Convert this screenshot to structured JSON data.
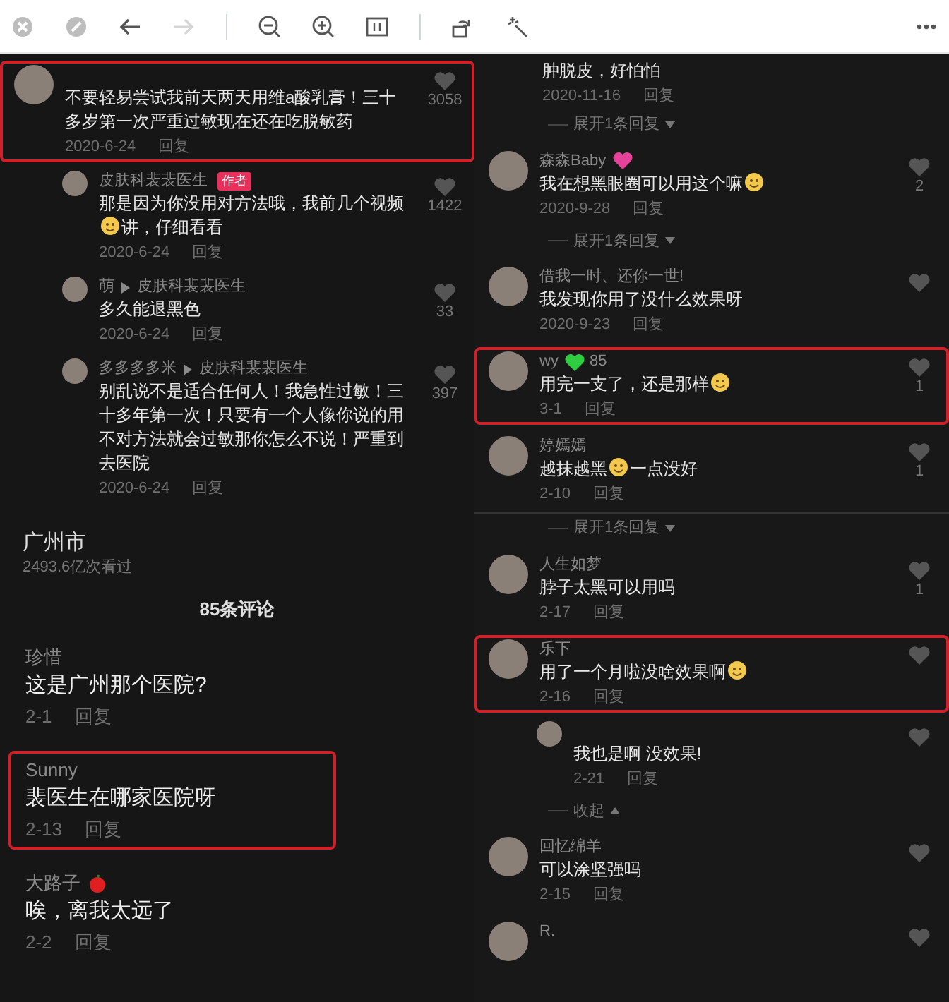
{
  "toolbar": [
    {
      "kind": "close"
    },
    {
      "kind": "minimize"
    },
    {
      "kind": "back",
      "disabled": false
    },
    {
      "kind": "forward",
      "disabled": true
    },
    {
      "kind": "separator"
    },
    {
      "kind": "zoom_out"
    },
    {
      "kind": "zoom_in"
    },
    {
      "kind": "fit"
    },
    {
      "kind": "separator"
    },
    {
      "kind": "rotate"
    },
    {
      "kind": "enhance"
    },
    {
      "kind": "spacer"
    },
    {
      "kind": "more"
    }
  ],
  "left_panel": [
    {
      "kind": "comment",
      "highlighted": true,
      "text": [
        "不要轻易尝试我前天两天用维a酸乳膏！三十多岁第一次严重过敏现在还在吃脱敏药"
      ],
      "date": "2020-6-24",
      "reply": "回复",
      "likes": "3058"
    },
    {
      "kind": "reply",
      "name": "皮肤科裴裴医生",
      "tag": "作者",
      "highlighted": false,
      "text": [
        "那是因为你没用对方法哦，我前几个视频",
        "讲，仔细看看"
      ],
      "date": "2020-6-24",
      "reply": "回复",
      "likes": "1422"
    },
    {
      "kind": "reply",
      "name": "萌",
      "reply_to": "皮肤科裴裴医生",
      "highlighted": false,
      "text": [
        "多久能退黑色"
      ],
      "date": "2020-6-24",
      "reply": "回复",
      "likes": "33"
    },
    {
      "kind": "reply",
      "name": "多多多多米",
      "reply_to": "皮肤科裴裴医生",
      "highlighted": false,
      "text": [
        "别乱说不是适合任何人！我急性过敏！三十多年第一次！只要有一个人像你说的用不对方法就会过敏那你怎么不说！严重到去医院"
      ],
      "date": "2020-6-24",
      "reply": "回复",
      "likes": "397"
    },
    {
      "kind": "location",
      "text": "广州市",
      "views": "2493.6亿次看过"
    },
    {
      "kind": "count",
      "text": "85条评论"
    },
    {
      "kind": "plain",
      "name": "珍惜",
      "highlighted": false,
      "text": [
        "这是广州那个医院?"
      ],
      "date": "2-1",
      "reply": "回复"
    },
    {
      "kind": "plain",
      "name": "Sunny",
      "highlighted": true,
      "text": [
        "裴医生在哪家医院呀"
      ],
      "date": "2-13",
      "reply": "回复"
    },
    {
      "kind": "plain",
      "name": "大路子",
      "badge": {
        "kind": "apple"
      },
      "highlighted": false,
      "text": [
        "唉，离我太远了"
      ],
      "date": "2-2",
      "reply": "回复"
    }
  ],
  "right_panel": [
    {
      "kind": "continuation",
      "text": [
        "肿脱皮，好怕怕"
      ],
      "date": "2020-11-16",
      "reply": "回复"
    },
    {
      "kind": "expand",
      "text": "展开1条回复"
    },
    {
      "kind": "comment",
      "name": "森森Baby",
      "badge": {
        "kind": "heart"
      },
      "highlighted": false,
      "text": [
        "我在想黑眼圈可以用这个嘛"
      ],
      "trailing_emoji": true,
      "date": "2020-9-28",
      "reply": "回复",
      "likes": "2"
    },
    {
      "kind": "expand",
      "text": "展开1条回复"
    },
    {
      "kind": "comment",
      "name": "借我一时、还你一世!",
      "highlighted": false,
      "text": [
        "我发现你用了没什么效果呀"
      ],
      "date": "2020-9-23",
      "reply": "回复"
    },
    {
      "kind": "comment",
      "name": "wy",
      "badge": {
        "kind": "green_heart"
      },
      "badge_text": "85",
      "highlighted": true,
      "text": [
        "用完一支了，还是那样"
      ],
      "trailing_emoji": true,
      "date": "3-1",
      "reply": "回复",
      "likes": "1"
    },
    {
      "kind": "comment",
      "name": "婷嫣嫣",
      "highlighted": false,
      "text": [
        "越抹越黑",
        "一点没好"
      ],
      "date": "2-10",
      "reply": "回复",
      "likes": "1"
    },
    {
      "kind": "expand",
      "text": "展开1条回复",
      "divider_above": true
    },
    {
      "kind": "comment",
      "name": "人生如梦",
      "highlighted": false,
      "text": [
        "脖子太黑可以用吗"
      ],
      "date": "2-17",
      "reply": "回复",
      "likes": "1"
    },
    {
      "kind": "comment",
      "name": "乐下",
      "highlighted": true,
      "text": [
        "用了一个月啦没啥效果啊"
      ],
      "trailing_emoji": true,
      "date": "2-16",
      "reply": "回复"
    },
    {
      "kind": "reply",
      "highlighted": false,
      "text": [
        "我也是啊 没效果!"
      ],
      "date": "2-21",
      "reply": "回复"
    },
    {
      "kind": "collapse",
      "text": "收起"
    },
    {
      "kind": "comment",
      "name": "回忆绵羊",
      "highlighted": false,
      "text": [
        "可以涂坚强吗"
      ],
      "date": "2-15",
      "reply": "回复"
    },
    {
      "kind": "comment",
      "name": "R.",
      "highlighted": false
    }
  ]
}
